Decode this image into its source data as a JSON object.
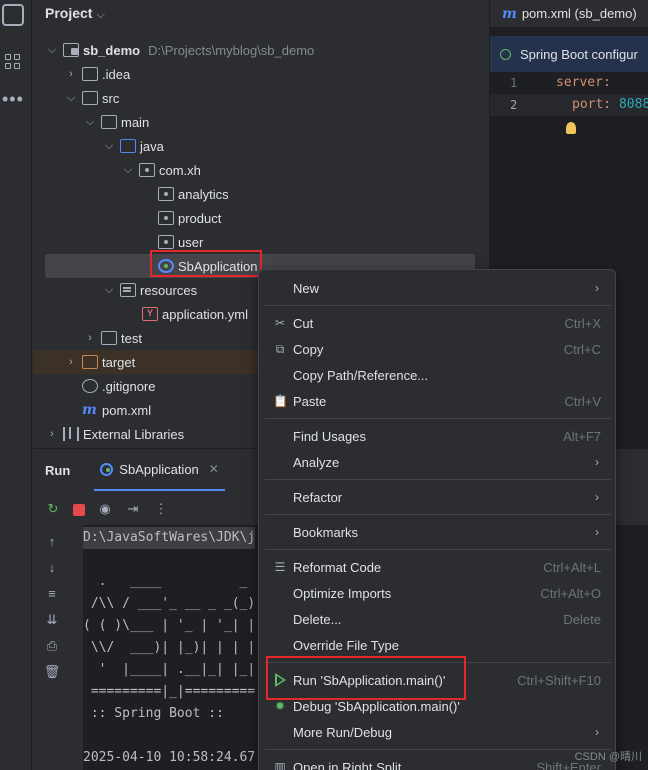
{
  "project": {
    "title": "Project",
    "tree": [
      {
        "label": "sb_demo",
        "path": "D:\\Projects\\myblog\\sb_demo",
        "icon": "module-folder-icon"
      },
      {
        "label": ".idea",
        "icon": "folder-icon"
      },
      {
        "label": "src",
        "icon": "folder-icon"
      },
      {
        "label": "main",
        "icon": "folder-icon"
      },
      {
        "label": "java",
        "icon": "source-folder-icon"
      },
      {
        "label": "com.xh",
        "icon": "package-icon"
      },
      {
        "label": "analytics",
        "icon": "package-icon"
      },
      {
        "label": "product",
        "icon": "package-icon"
      },
      {
        "label": "user",
        "icon": "package-icon"
      },
      {
        "label": "SbApplication",
        "icon": "spring-boot-class-icon"
      },
      {
        "label": "resources",
        "icon": "resources-folder-icon"
      },
      {
        "label": "application.yml",
        "icon": "yaml-file-icon"
      },
      {
        "label": "test",
        "icon": "folder-icon"
      },
      {
        "label": "target",
        "icon": "folder-icon"
      },
      {
        "label": ".gitignore",
        "icon": "gitignore-icon"
      },
      {
        "label": "pom.xml",
        "icon": "maven-icon"
      },
      {
        "label": "External Libraries",
        "icon": "libraries-icon"
      }
    ]
  },
  "editor": {
    "tab": "pom.xml (sb_demo)",
    "banner": "Spring Boot configur",
    "lines": [
      {
        "num": "1",
        "key": "server:",
        "value": ""
      },
      {
        "num": "2",
        "key": "port:",
        "value": "8088"
      }
    ]
  },
  "run": {
    "title": "Run",
    "tab": "SbApplication",
    "console": [
      "D:\\JavaSoftWares\\JDK\\j",
      "",
      "  .   ____          _",
      " /\\\\ / ___'_ __ _ _(_)",
      "( ( )\\___ | '_ | '_| |",
      " \\\\/  ___)| |_)| | | |",
      "  '  |____| .__|_| |_|",
      " =========|_|=========",
      " :: Spring Boot ::",
      "",
      "2025-04-10 10:58:24.67"
    ]
  },
  "menu": {
    "items": [
      {
        "label": "New",
        "shortcut": "",
        "submenu": true,
        "icon": ""
      },
      {
        "label": "Cut",
        "shortcut": "Ctrl+X",
        "submenu": false,
        "icon": "scissors-icon"
      },
      {
        "label": "Copy",
        "shortcut": "Ctrl+C",
        "submenu": false,
        "icon": "copy-icon"
      },
      {
        "label": "Copy Path/Reference...",
        "shortcut": "",
        "submenu": false,
        "icon": ""
      },
      {
        "label": "Paste",
        "shortcut": "Ctrl+V",
        "submenu": false,
        "icon": "paste-icon"
      },
      {
        "label": "Find Usages",
        "shortcut": "Alt+F7",
        "submenu": false,
        "icon": ""
      },
      {
        "label": "Analyze",
        "shortcut": "",
        "submenu": true,
        "icon": ""
      },
      {
        "label": "Refactor",
        "shortcut": "",
        "submenu": true,
        "icon": ""
      },
      {
        "label": "Bookmarks",
        "shortcut": "",
        "submenu": true,
        "icon": ""
      },
      {
        "label": "Reformat Code",
        "shortcut": "Ctrl+Alt+L",
        "submenu": false,
        "icon": "reformat-icon"
      },
      {
        "label": "Optimize Imports",
        "shortcut": "Ctrl+Alt+O",
        "submenu": false,
        "icon": ""
      },
      {
        "label": "Delete...",
        "shortcut": "Delete",
        "submenu": false,
        "icon": ""
      },
      {
        "label": "Override File Type",
        "shortcut": "",
        "submenu": false,
        "icon": ""
      },
      {
        "label": "Run 'SbApplication.main()'",
        "shortcut": "Ctrl+Shift+F10",
        "submenu": false,
        "icon": "run-icon"
      },
      {
        "label": "Debug 'SbApplication.main()'",
        "shortcut": "",
        "submenu": false,
        "icon": "debug-icon"
      },
      {
        "label": "More Run/Debug",
        "shortcut": "",
        "submenu": true,
        "icon": ""
      },
      {
        "label": "Open in Right Split",
        "shortcut": "Shift+Enter",
        "submenu": false,
        "icon": "split-icon"
      }
    ]
  },
  "watermark": "CSDN @晴川",
  "colors": {
    "accent": "#548af7",
    "highlight_border": "#e5272a",
    "run_green": "#5fb865"
  }
}
